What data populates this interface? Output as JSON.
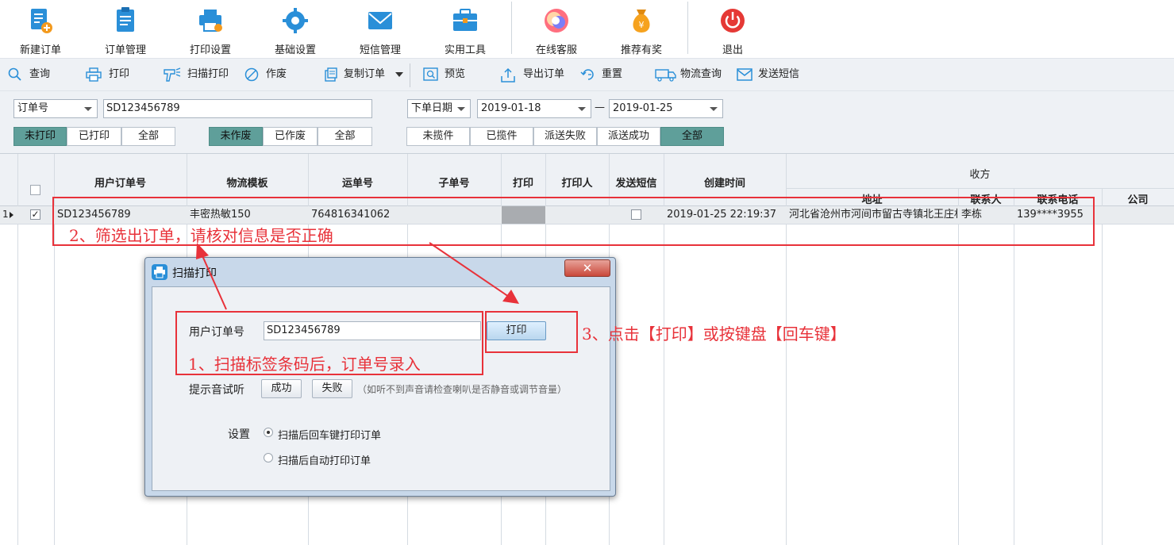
{
  "toolbar": {
    "items": [
      {
        "label": "新建订单",
        "icon": "new-order-icon"
      },
      {
        "label": "订单管理",
        "icon": "clipboard-icon"
      },
      {
        "label": "打印设置",
        "icon": "printer-icon"
      },
      {
        "label": "基础设置",
        "icon": "gear-icon"
      },
      {
        "label": "短信管理",
        "icon": "envelope-icon"
      },
      {
        "label": "实用工具",
        "icon": "toolbox-icon"
      },
      {
        "label": "在线客服",
        "icon": "customer-service-icon"
      },
      {
        "label": "推荐有奖",
        "icon": "money-bag-icon"
      },
      {
        "label": "退出",
        "icon": "power-icon"
      }
    ]
  },
  "actions": {
    "query": "查询",
    "print": "打印",
    "scan_print": "扫描打印",
    "void": "作废",
    "copy_order": "复制订单",
    "preview": "预览",
    "export_order": "导出订单",
    "reset": "重置",
    "logistics_query": "物流查询",
    "send_sms": "发送短信"
  },
  "filters": {
    "field_select": "订单号",
    "order_input": "SD123456789",
    "date_type_select": "下单日期",
    "date_from": "2019-01-18",
    "date_sep": "—",
    "date_to": "2019-01-25",
    "print_status": [
      "未打印",
      "已打印",
      "全部"
    ],
    "void_status": [
      "未作废",
      "已作废",
      "全部"
    ],
    "pickup_status": [
      "未揽件",
      "已揽件",
      "派送失败",
      "派送成功",
      "全部"
    ],
    "active": {
      "print_status": 0,
      "void_status": 0,
      "pickup_status": 4
    }
  },
  "table": {
    "headers": {
      "user_order_no": "用户订单号",
      "logistics_template": "物流模板",
      "waybill_no": "运单号",
      "sub_order_no": "子单号",
      "printed": "打印",
      "printer": "打印人",
      "send_sms": "发送短信",
      "created_time": "创建时间",
      "receiver_group": "收方",
      "address": "地址",
      "contact": "联系人",
      "phone": "联系电话",
      "company": "公司"
    },
    "rows": [
      {
        "index": "1",
        "checked": true,
        "user_order_no": "SD123456789",
        "logistics_template": "丰密热敏150",
        "waybill_no": "764816341062",
        "sub_order_no": "",
        "printer": "",
        "sms_checked": false,
        "created_time": "2019-01-25 22:19:37",
        "address": "河北省沧州市河间市留古寺镇北王庄村",
        "contact": "李栋",
        "phone": "139****3955",
        "company": ""
      }
    ]
  },
  "dialog": {
    "title": "扫描打印",
    "close_glyph": "✕",
    "order_label": "用户订单号",
    "order_value": "SD123456789",
    "print_button": "打印",
    "sound_label": "提示音试听",
    "success_button": "成功",
    "fail_button": "失败",
    "sound_hint": "（如听不到声音请检查喇叭是否静音或调节音量）",
    "settings_label": "设置",
    "option_enter": "扫描后回车键打印订单",
    "option_auto": "扫描后自动打印订单",
    "selected_option": "option_enter"
  },
  "annotations": {
    "step1": "1、扫描标签条码后，订单号录入",
    "step2": "2、筛选出订单，请核对信息是否正确",
    "step3": "3、点击【打印】或按键盘【回车键】"
  },
  "colors": {
    "annotation_red": "#e8323a",
    "active_tab_teal": "#5f9f9a",
    "toolbar_bg": "#eef1f5"
  }
}
